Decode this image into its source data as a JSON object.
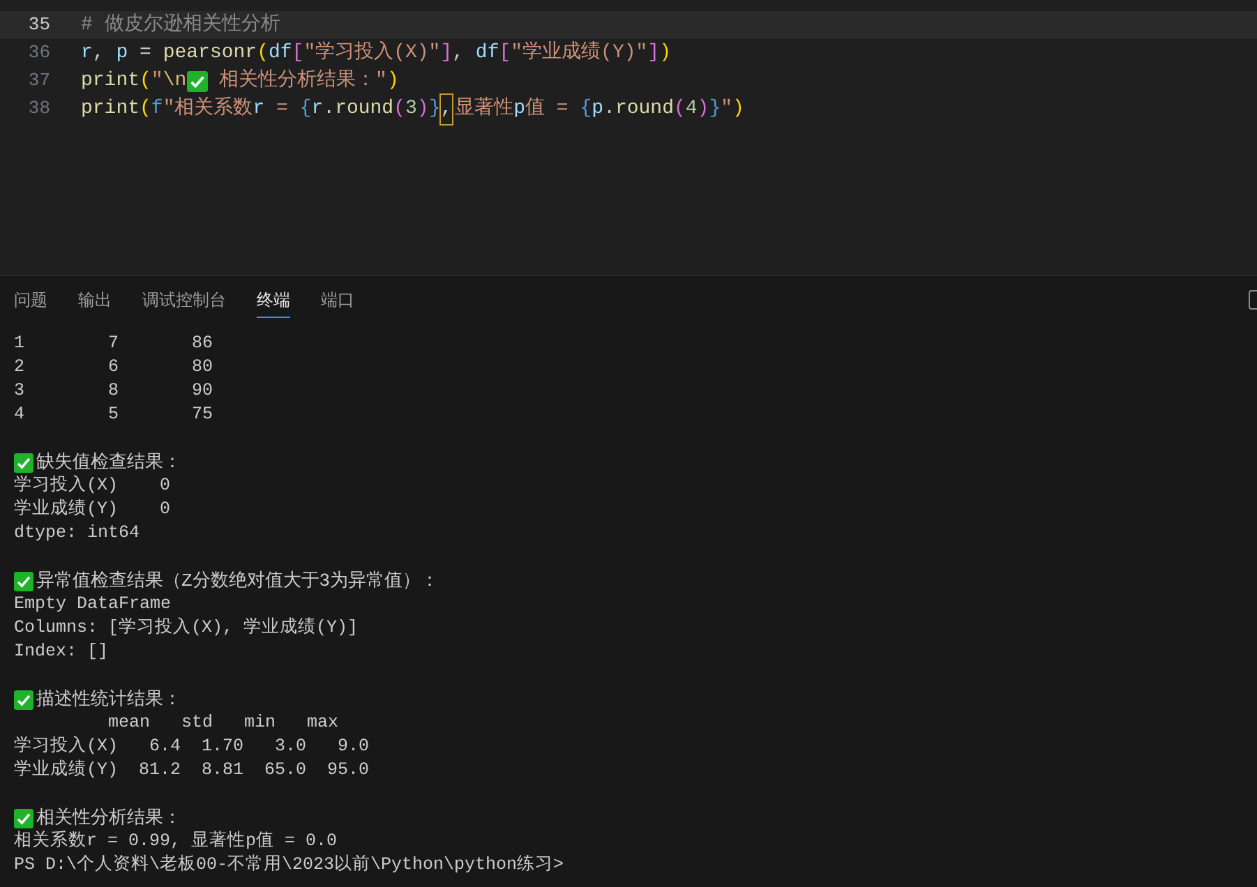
{
  "editor": {
    "lines": [
      {
        "number": "35",
        "current": true,
        "tokens": [
          {
            "kind": "comment",
            "text": "# 做皮尔逊相关性分析"
          }
        ]
      },
      {
        "number": "36",
        "current": false,
        "tokens": [
          {
            "kind": "var",
            "text": "r"
          },
          {
            "kind": "plain",
            "text": ", "
          },
          {
            "kind": "var",
            "text": "p"
          },
          {
            "kind": "plain",
            "text": " = "
          },
          {
            "kind": "fn",
            "text": "pearsonr"
          },
          {
            "kind": "br1",
            "text": "("
          },
          {
            "kind": "var",
            "text": "df"
          },
          {
            "kind": "br2",
            "text": "["
          },
          {
            "kind": "str",
            "text": "\"学习投入(X)\""
          },
          {
            "kind": "br2",
            "text": "]"
          },
          {
            "kind": "plain",
            "text": ", "
          },
          {
            "kind": "var",
            "text": "df"
          },
          {
            "kind": "br2",
            "text": "["
          },
          {
            "kind": "str",
            "text": "\"学业成绩(Y)\""
          },
          {
            "kind": "br2",
            "text": "]"
          },
          {
            "kind": "br1",
            "text": ")"
          }
        ]
      },
      {
        "number": "37",
        "current": false,
        "tokens": [
          {
            "kind": "fn",
            "text": "print"
          },
          {
            "kind": "br1",
            "text": "("
          },
          {
            "kind": "str",
            "text": "\""
          },
          {
            "kind": "esc",
            "text": "\\n"
          },
          {
            "kind": "emoji"
          },
          {
            "kind": "str",
            "text": " 相关性分析结果：\""
          },
          {
            "kind": "br1",
            "text": ")"
          }
        ]
      },
      {
        "number": "38",
        "current": false,
        "tokens": [
          {
            "kind": "fn",
            "text": "print"
          },
          {
            "kind": "br1",
            "text": "("
          },
          {
            "kind": "kw",
            "text": "f"
          },
          {
            "kind": "str",
            "text": "\"相关系数"
          },
          {
            "kind": "var",
            "text": "r"
          },
          {
            "kind": "str",
            "text": " = "
          },
          {
            "kind": "kw",
            "text": "{"
          },
          {
            "kind": "var",
            "text": "r"
          },
          {
            "kind": "plain",
            "text": "."
          },
          {
            "kind": "fn",
            "text": "round"
          },
          {
            "kind": "br2",
            "text": "("
          },
          {
            "kind": "num",
            "text": "3"
          },
          {
            "kind": "br2",
            "text": ")"
          },
          {
            "kind": "kw",
            "text": "}"
          },
          {
            "kind": "match",
            "text": ","
          },
          {
            "kind": "str",
            "text": "显著性"
          },
          {
            "kind": "var",
            "text": "p"
          },
          {
            "kind": "str",
            "text": "值 = "
          },
          {
            "kind": "kw",
            "text": "{"
          },
          {
            "kind": "var",
            "text": "p"
          },
          {
            "kind": "plain",
            "text": "."
          },
          {
            "kind": "fn",
            "text": "round"
          },
          {
            "kind": "br2",
            "text": "("
          },
          {
            "kind": "num",
            "text": "4"
          },
          {
            "kind": "br2",
            "text": ")"
          },
          {
            "kind": "kw",
            "text": "}"
          },
          {
            "kind": "str",
            "text": "\""
          },
          {
            "kind": "br1",
            "text": ")"
          }
        ]
      }
    ]
  },
  "panel_tabs": [
    {
      "label": "问题",
      "selected": false
    },
    {
      "label": "输出",
      "selected": false
    },
    {
      "label": "调试控制台",
      "selected": false
    },
    {
      "label": "终端",
      "selected": true
    },
    {
      "label": "端口",
      "selected": false
    }
  ],
  "terminal": {
    "lines": [
      {
        "kind": "text",
        "text": "1        7       86"
      },
      {
        "kind": "text",
        "text": "2        6       80"
      },
      {
        "kind": "text",
        "text": "3        8       90"
      },
      {
        "kind": "text",
        "text": "4        5       75"
      },
      {
        "kind": "blank"
      },
      {
        "kind": "check",
        "text": "缺失值检查结果："
      },
      {
        "kind": "text",
        "text": "学习投入(X)    0"
      },
      {
        "kind": "text",
        "text": "学业成绩(Y)    0"
      },
      {
        "kind": "text",
        "text": "dtype: int64"
      },
      {
        "kind": "blank"
      },
      {
        "kind": "check",
        "text": "异常值检查结果（Z分数绝对值大于3为异常值）："
      },
      {
        "kind": "text",
        "text": "Empty DataFrame"
      },
      {
        "kind": "text",
        "text": "Columns: [学习投入(X), 学业成绩(Y)]"
      },
      {
        "kind": "text",
        "text": "Index: []"
      },
      {
        "kind": "blank"
      },
      {
        "kind": "check",
        "text": "描述性统计结果："
      },
      {
        "kind": "text",
        "text": "         mean   std   min   max"
      },
      {
        "kind": "text",
        "text": "学习投入(X)   6.4  1.70   3.0   9.0"
      },
      {
        "kind": "text",
        "text": "学业成绩(Y)  81.2  8.81  65.0  95.0"
      },
      {
        "kind": "blank"
      },
      {
        "kind": "check",
        "text": "相关性分析结果："
      },
      {
        "kind": "text",
        "text": "相关系数r = 0.99, 显著性p值 = 0.0"
      },
      {
        "kind": "text",
        "text": "PS D:\\个人资料\\老板00-不常用\\2023以前\\Python\\python练习>"
      }
    ]
  }
}
